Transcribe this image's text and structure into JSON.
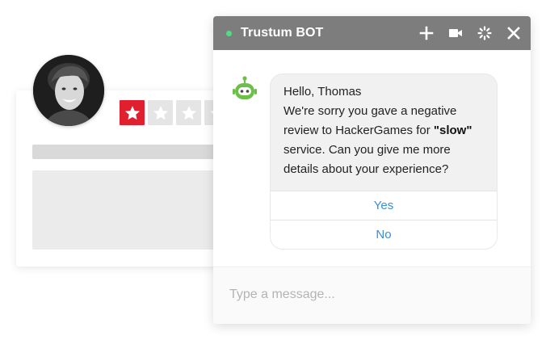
{
  "review": {
    "rating": 1,
    "max_rating": 5,
    "colors": {
      "star_filled": "#e0202e",
      "star_empty": "#e5e5e5"
    }
  },
  "chat": {
    "title": "Trustum BOT",
    "status": "online",
    "header_icons": [
      "plus-icon",
      "video-camera-icon",
      "loading-spinner-icon",
      "close-icon"
    ],
    "message": {
      "greeting": "Hello, Thomas",
      "text_before": "We're sorry you gave a negative review to HackerGames for ",
      "highlight": "\"slow\"",
      "text_after": " service. Can you give me more details about your experience?"
    },
    "options": {
      "yes": "Yes",
      "no": "No"
    },
    "input_placeholder": "Type a message..."
  },
  "colors": {
    "header_bg": "#7d7d7d",
    "status_online": "#55d98b",
    "link_blue": "#3a8fd6",
    "bot_green": "#6cc04a"
  }
}
